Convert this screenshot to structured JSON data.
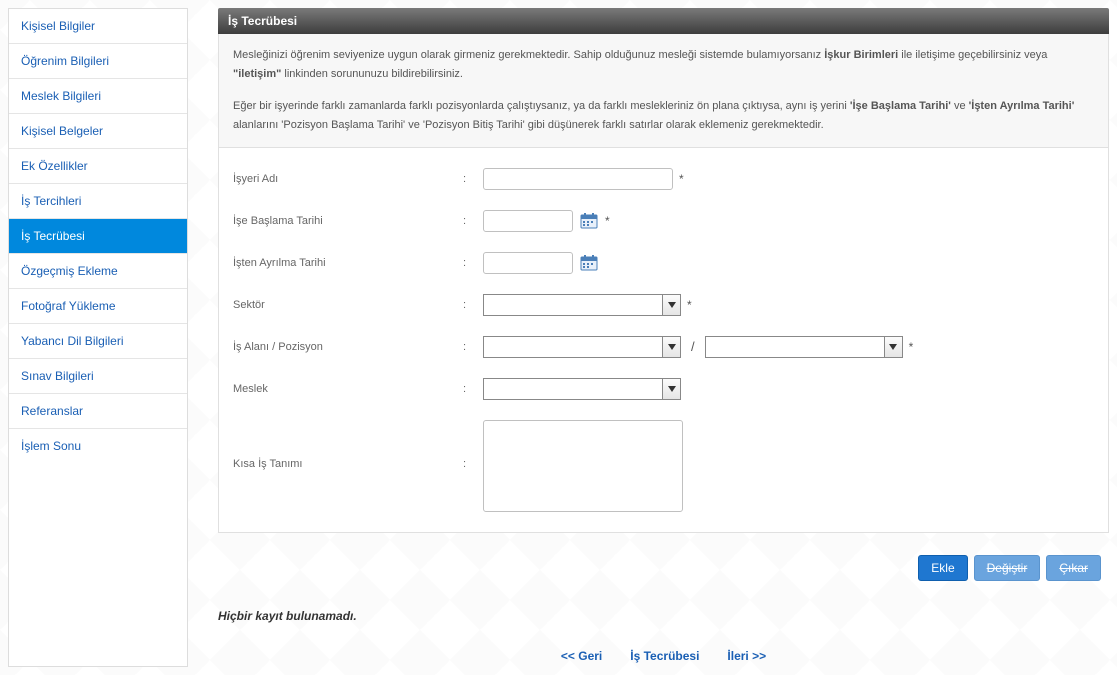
{
  "sidebar": {
    "items": [
      {
        "label": "Kişisel Bilgiler",
        "active": false
      },
      {
        "label": "Öğrenim Bilgileri",
        "active": false
      },
      {
        "label": "Meslek Bilgileri",
        "active": false
      },
      {
        "label": "Kişisel Belgeler",
        "active": false
      },
      {
        "label": "Ek Özellikler",
        "active": false
      },
      {
        "label": "İş Tercihleri",
        "active": false
      },
      {
        "label": "İş Tecrübesi",
        "active": true
      },
      {
        "label": "Özgeçmiş Ekleme",
        "active": false
      },
      {
        "label": "Fotoğraf Yükleme",
        "active": false
      },
      {
        "label": "Yabancı Dil Bilgileri",
        "active": false
      },
      {
        "label": "Sınav Bilgileri",
        "active": false
      },
      {
        "label": "Referanslar",
        "active": false
      },
      {
        "label": "İşlem Sonu",
        "active": false
      }
    ]
  },
  "panel": {
    "title": "İş Tecrübesi",
    "info_p1_a": "Mesleğinizi öğrenim seviyenize uygun olarak girmeniz gerekmektedir. Sahip olduğunuz mesleği sistemde bulamıyorsanız ",
    "info_p1_b": "İşkur Birimleri",
    "info_p1_c": " ile iletişime geçebilirsiniz veya ",
    "info_p1_d": "\"iletişim\"",
    "info_p1_e": " linkinden sorununuzu bildirebilirsiniz.",
    "info_p2_a": "Eğer bir işyerinde farklı zamanlarda farklı pozisyonlarda çalıştıysanız, ya da farklı meslekleriniz ön plana çıktıysa, aynı iş yerini ",
    "info_p2_b": "'İşe Başlama Tarihi'",
    "info_p2_c": " ve ",
    "info_p2_d": "'İşten Ayrılma Tarihi'",
    "info_p2_e": " alanlarını 'Pozisyon Başlama Tarihi' ve 'Pozisyon Bitiş Tarihi' gibi düşünerek farklı satırlar olarak eklemeniz gerekmektedir."
  },
  "form": {
    "workplace_label": "İşyeri Adı",
    "workplace_value": "",
    "startdate_label": "İşe Başlama Tarihi",
    "startdate_value": "",
    "enddate_label": "İşten Ayrılma Tarihi",
    "enddate_value": "",
    "sector_label": "Sektör",
    "sector_value": "",
    "field_label": "İş Alanı / Pozisyon",
    "field_value": "",
    "position_value": "",
    "profession_label": "Meslek",
    "profession_value": "",
    "jobdesc_label": "Kısa İş Tanımı",
    "jobdesc_value": "",
    "required_mark": "*",
    "slash": "/",
    "colon": ":"
  },
  "buttons": {
    "add": "Ekle",
    "change": "Değiştir",
    "remove": "Çıkar"
  },
  "status": {
    "no_record": "Hiçbir kayıt bulunamadı."
  },
  "nav": {
    "prev": "<< Geri",
    "current": "İş Tecrübesi",
    "next": "İleri >>"
  }
}
